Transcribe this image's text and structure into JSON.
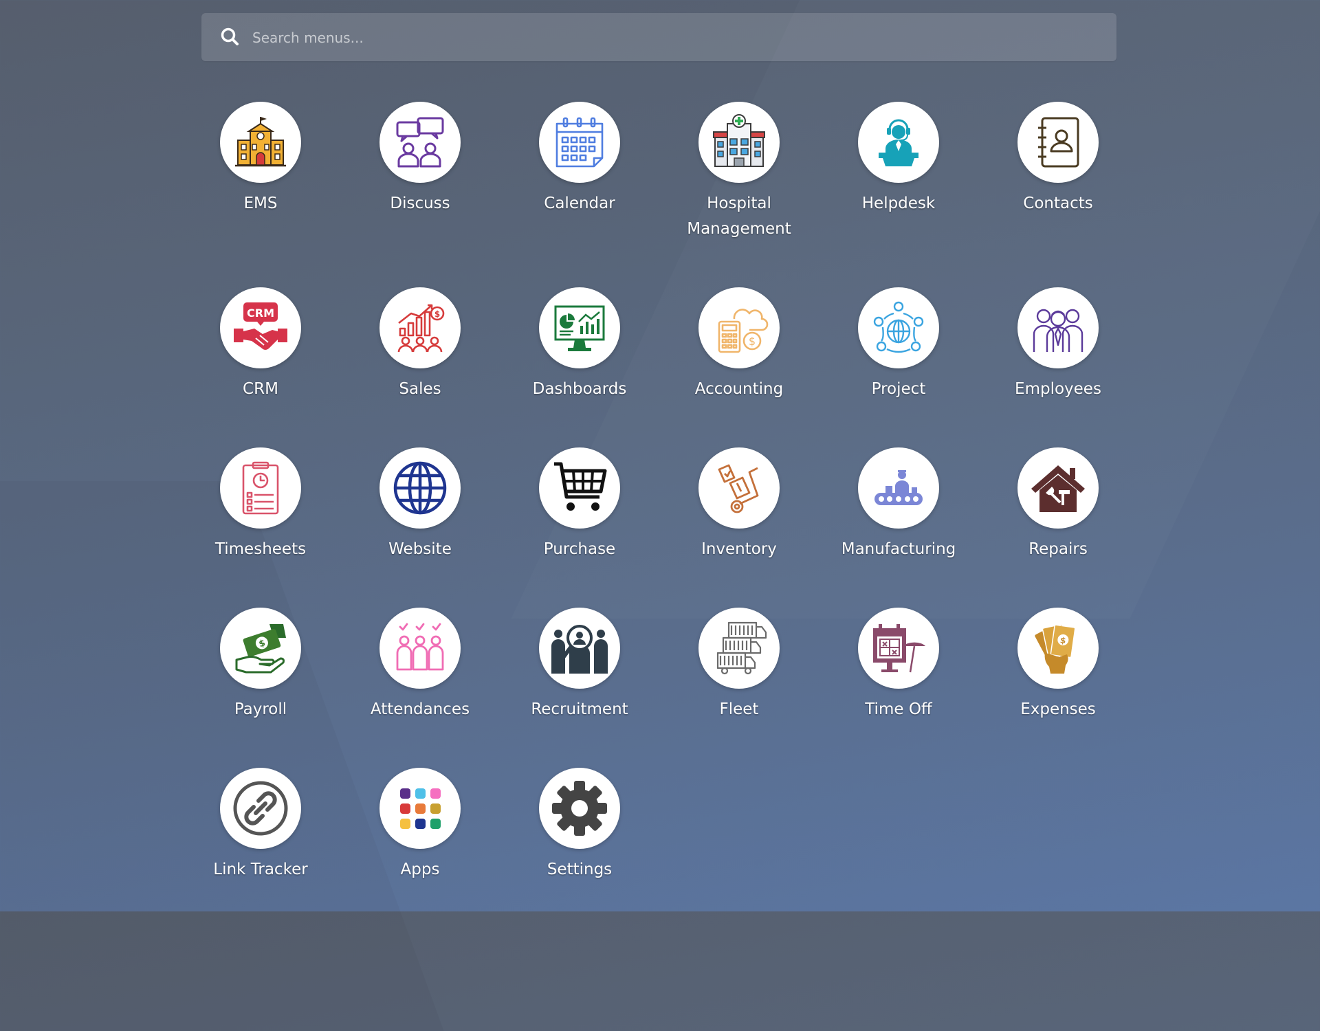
{
  "search": {
    "placeholder": "Search menus...",
    "icon": "search-icon"
  },
  "apps": [
    {
      "label": "EMS",
      "icon": "school-building-icon"
    },
    {
      "label": "Discuss",
      "icon": "chat-people-icon"
    },
    {
      "label": "Calendar",
      "icon": "calendar-icon"
    },
    {
      "label": "Hospital Management",
      "icon": "hospital-icon"
    },
    {
      "label": "Helpdesk",
      "icon": "support-agent-icon"
    },
    {
      "label": "Contacts",
      "icon": "address-book-icon"
    },
    {
      "label": "CRM",
      "icon": "crm-handshake-icon"
    },
    {
      "label": "Sales",
      "icon": "sales-growth-icon"
    },
    {
      "label": "Dashboards",
      "icon": "dashboard-monitor-icon"
    },
    {
      "label": "Accounting",
      "icon": "calculator-cloud-icon"
    },
    {
      "label": "Project",
      "icon": "project-network-icon"
    },
    {
      "label": "Employees",
      "icon": "employees-group-icon"
    },
    {
      "label": "Timesheets",
      "icon": "timesheet-clipboard-icon"
    },
    {
      "label": "Website",
      "icon": "globe-icon"
    },
    {
      "label": "Purchase",
      "icon": "shopping-cart-icon"
    },
    {
      "label": "Inventory",
      "icon": "hand-truck-icon"
    },
    {
      "label": "Manufacturing",
      "icon": "conveyor-worker-icon"
    },
    {
      "label": "Repairs",
      "icon": "house-tools-icon"
    },
    {
      "label": "Payroll",
      "icon": "money-hand-icon"
    },
    {
      "label": "Attendances",
      "icon": "attendance-check-icon"
    },
    {
      "label": "Recruitment",
      "icon": "recruitment-search-icon"
    },
    {
      "label": "Fleet",
      "icon": "trucks-icon"
    },
    {
      "label": "Time Off",
      "icon": "calendar-beach-icon"
    },
    {
      "label": "Expenses",
      "icon": "expenses-money-icon"
    },
    {
      "label": "Link Tracker",
      "icon": "link-icon"
    },
    {
      "label": "Apps",
      "icon": "apps-grid-icon"
    },
    {
      "label": "Settings",
      "icon": "gear-icon"
    }
  ],
  "colors": {
    "background_top": "#565e6d",
    "background_bottom": "#5b76a3",
    "tile_background": "#ffffff",
    "label_text": "#ffffff"
  }
}
